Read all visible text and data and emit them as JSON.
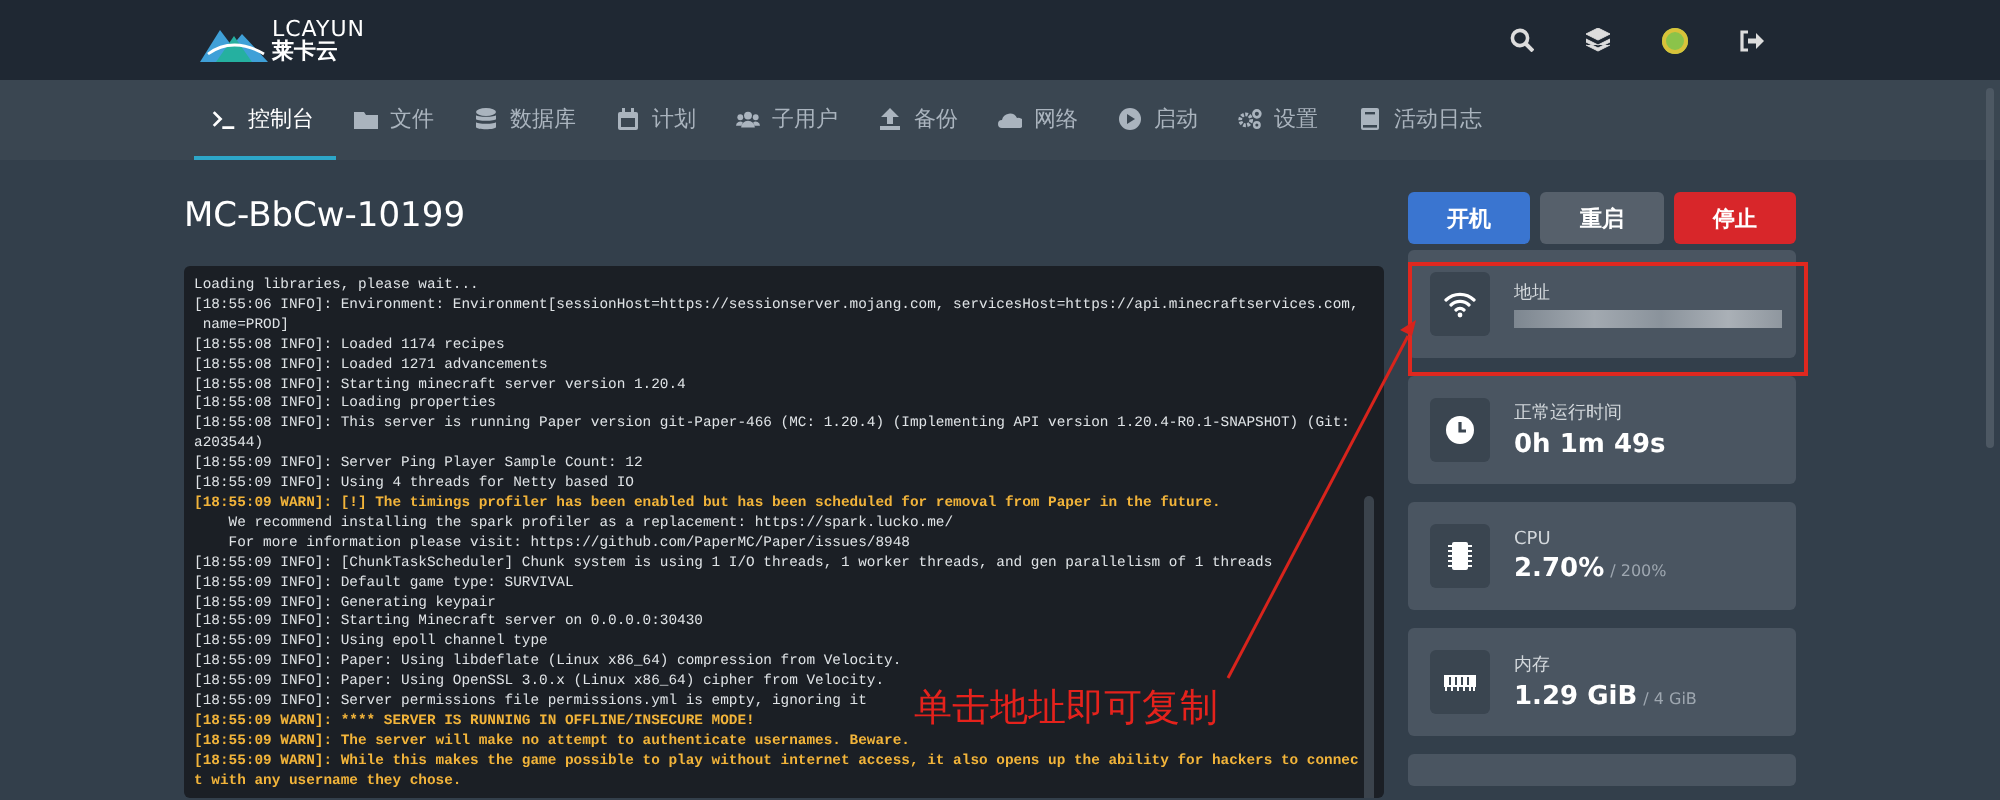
{
  "header": {
    "logo": {
      "brand": "LCAYUN",
      "brand_cn": "莱卡云"
    }
  },
  "nav": {
    "tabs": [
      {
        "label": "控制台",
        "selected": true
      },
      {
        "label": "文件",
        "selected": false
      },
      {
        "label": "数据库",
        "selected": false
      },
      {
        "label": "计划",
        "selected": false
      },
      {
        "label": "子用户",
        "selected": false
      },
      {
        "label": "备份",
        "selected": false
      },
      {
        "label": "网络",
        "selected": false
      },
      {
        "label": "启动",
        "selected": false
      },
      {
        "label": "设置",
        "selected": false
      },
      {
        "label": "活动日志",
        "selected": false
      }
    ]
  },
  "server": {
    "name": "MC-BbCw-10199"
  },
  "console": {
    "lines": [
      {
        "kind": "info",
        "text": "Loading libraries, please wait..."
      },
      {
        "kind": "info",
        "text": "[18:55:06 INFO]: Environment: Environment[sessionHost=https://sessionserver.mojang.com, servicesHost=https://api.minecraftservices.com,"
      },
      {
        "kind": "info",
        "text": " name=PROD]"
      },
      {
        "kind": "info",
        "text": "[18:55:08 INFO]: Loaded 1174 recipes"
      },
      {
        "kind": "info",
        "text": "[18:55:08 INFO]: Loaded 1271 advancements"
      },
      {
        "kind": "info",
        "text": "[18:55:08 INFO]: Starting minecraft server version 1.20.4"
      },
      {
        "kind": "info",
        "text": "[18:55:08 INFO]: Loading properties"
      },
      {
        "kind": "info",
        "text": "[18:55:08 INFO]: This server is running Paper version git-Paper-466 (MC: 1.20.4) (Implementing API version 1.20.4-R0.1-SNAPSHOT) (Git:"
      },
      {
        "kind": "info",
        "text": "a203544)"
      },
      {
        "kind": "info",
        "text": "[18:55:09 INFO]: Server Ping Player Sample Count: 12"
      },
      {
        "kind": "info",
        "text": "[18:55:09 INFO]: Using 4 threads for Netty based IO"
      },
      {
        "kind": "warn",
        "text": "[18:55:09 WARN]: [!] The timings profiler has been enabled but has been scheduled for removal from Paper in the future."
      },
      {
        "kind": "info",
        "text": "    We recommend installing the spark profiler as a replacement: https://spark.lucko.me/"
      },
      {
        "kind": "info",
        "text": "    For more information please visit: https://github.com/PaperMC/Paper/issues/8948"
      },
      {
        "kind": "info",
        "text": "[18:55:09 INFO]: [ChunkTaskScheduler] Chunk system is using 1 I/O threads, 1 worker threads, and gen parallelism of 1 threads"
      },
      {
        "kind": "info",
        "text": "[18:55:09 INFO]: Default game type: SURVIVAL"
      },
      {
        "kind": "info",
        "text": "[18:55:09 INFO]: Generating keypair"
      },
      {
        "kind": "info",
        "text": "[18:55:09 INFO]: Starting Minecraft server on 0.0.0.0:30430"
      },
      {
        "kind": "info",
        "text": "[18:55:09 INFO]: Using epoll channel type"
      },
      {
        "kind": "info",
        "text": "[18:55:09 INFO]: Paper: Using libdeflate (Linux x86_64) compression from Velocity."
      },
      {
        "kind": "info",
        "text": "[18:55:09 INFO]: Paper: Using OpenSSL 3.0.x (Linux x86_64) cipher from Velocity."
      },
      {
        "kind": "info",
        "text": "[18:55:09 INFO]: Server permissions file permissions.yml is empty, ignoring it"
      },
      {
        "kind": "warn",
        "text": "[18:55:09 WARN]: **** SERVER IS RUNNING IN OFFLINE/INSECURE MODE!"
      },
      {
        "kind": "warn",
        "text": "[18:55:09 WARN]: The server will make no attempt to authenticate usernames. Beware."
      },
      {
        "kind": "warn",
        "text": "[18:55:09 WARN]: While this makes the game possible to play without internet access, it also opens up the ability for hackers to connec"
      },
      {
        "kind": "warn",
        "text": "t with any username they chose."
      }
    ]
  },
  "power_buttons": [
    {
      "label": "开机",
      "kind": "start"
    },
    {
      "label": "重启",
      "kind": "restart"
    },
    {
      "label": "停止",
      "kind": "stop"
    }
  ],
  "stats": [
    {
      "label": "地址",
      "kind": "blurred"
    },
    {
      "label": "正常运行时间",
      "kind": "value",
      "value": "0h 1m 49s"
    },
    {
      "label": "CPU",
      "kind": "value",
      "value": "2.70%",
      "limit": "/ 200%"
    },
    {
      "label": "内存",
      "kind": "value",
      "value": "1.29 GiB",
      "limit": "/ 4 GiB"
    },
    {
      "kind": "empty"
    }
  ],
  "annotation": {
    "text": "单击地址即可复制"
  }
}
